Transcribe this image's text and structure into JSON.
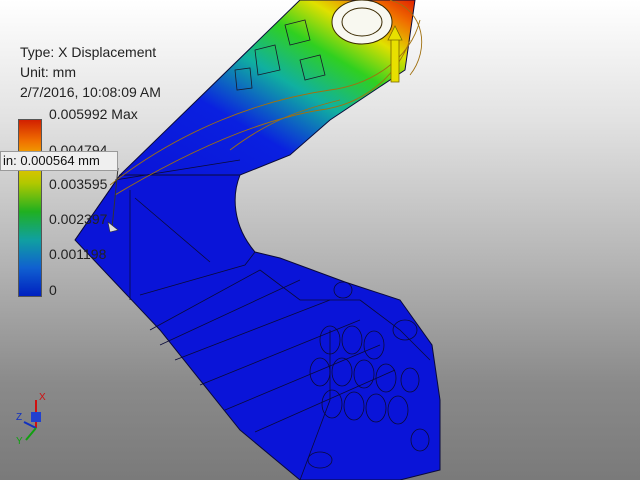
{
  "result": {
    "type_label": "Type: X Displacement",
    "unit_label": "Unit: mm",
    "timestamp": "2/7/2016, 10:08:09 AM"
  },
  "legend": {
    "max_label": "0.005992 Max",
    "labels": [
      "0.004794",
      "0.003595",
      "0.002397",
      "0.001198",
      "0"
    ],
    "colors": [
      "#d22000",
      "#f0c000",
      "#20b020",
      "#10a0a0",
      "#0020c0"
    ]
  },
  "probe": {
    "text": "in: 0.000564 mm"
  },
  "triad": {
    "x_axis_label": "X",
    "y_axis_label": "Y",
    "z_axis_label": "Z"
  },
  "colors": {
    "part_blue": "#0a14d8",
    "edge_lines": "#0a0a3a",
    "load_arrow": "#e8e000"
  }
}
